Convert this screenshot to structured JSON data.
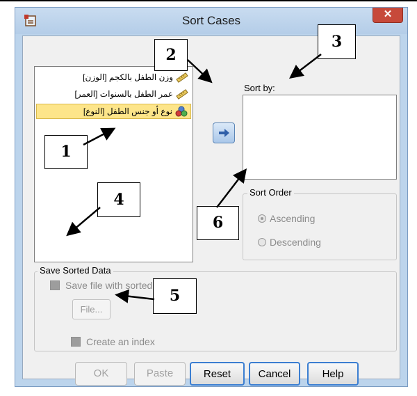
{
  "window": {
    "title": "Sort Cases",
    "close_glyph": "✕"
  },
  "variables": [
    {
      "label": "وزن الطفل بالكجم [الوزن]",
      "icon": "ruler-icon"
    },
    {
      "label": "عمر الطفل بالسنوات [العمر]",
      "icon": "ruler-icon"
    },
    {
      "label": "نوع أو جنس الطفل [النوع]",
      "icon": "nominal-icon",
      "selected": true
    }
  ],
  "move_button": {
    "glyph": "➜",
    "icon": "right-arrow-icon"
  },
  "sort_by": {
    "label": "Sort by:"
  },
  "sort_order": {
    "label": "Sort Order",
    "ascending": "Ascending",
    "descending": "Descending",
    "selected": "Ascending"
  },
  "save_sorted": {
    "label": "Save Sorted Data",
    "save_file": "Save file with sorted data",
    "file_button": "File...",
    "create_index": "Create an index"
  },
  "buttons": {
    "ok": "OK",
    "paste": "Paste",
    "reset": "Reset",
    "cancel": "Cancel",
    "help": "Help"
  },
  "annotations": {
    "n1": "1",
    "n2": "2",
    "n3": "3",
    "n4": "4",
    "n5": "5",
    "n6": "6"
  },
  "colors": {
    "title_bg": "#bcd4ec",
    "selected_row": "#fde58a",
    "close": "#c7493a",
    "focus_border": "#3b7ed1"
  }
}
